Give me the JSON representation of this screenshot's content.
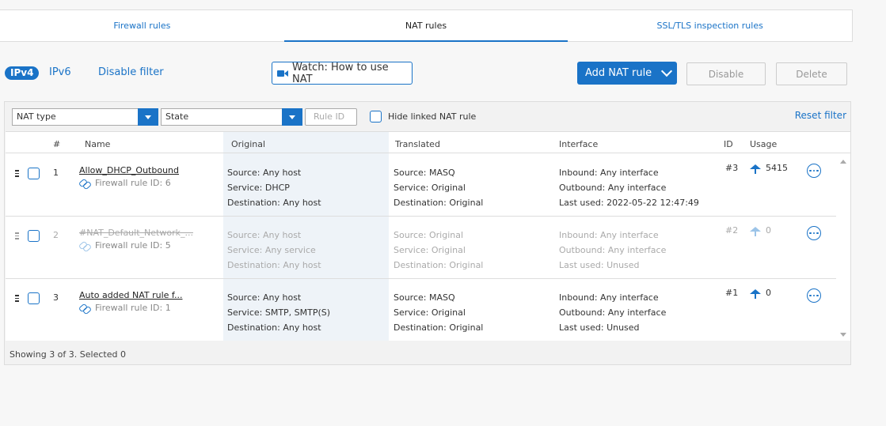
{
  "tabs": [
    {
      "label": "Firewall rules"
    },
    {
      "label": "NAT rules"
    },
    {
      "label": "SSL/TLS inspection rules"
    }
  ],
  "toolbar": {
    "ipv4": "IPv4",
    "ipv6": "IPv6",
    "disable_filter": "Disable filter",
    "watch": "Watch: How to use NAT",
    "add_nat_rule": "Add NAT rule",
    "disable": "Disable",
    "delete": "Delete"
  },
  "filters": {
    "nat_type": "NAT type",
    "state": "State",
    "rule_id_placeholder": "Rule ID",
    "hide_linked": "Hide linked NAT rule",
    "reset": "Reset filter"
  },
  "columns": {
    "num": "#",
    "name": "Name",
    "original": "Original",
    "translated": "Translated",
    "interface": "Interface",
    "id": "ID",
    "usage": "Usage"
  },
  "rows": [
    {
      "num": "1",
      "name": "Allow_DHCP_Outbound",
      "fw": "Firewall rule ID: 6",
      "orig_source": "Source: Any host",
      "orig_service": "Service: DHCP",
      "orig_dest": "Destination: Any host",
      "tr_source": "Source: MASQ",
      "tr_service": "Service: Original",
      "tr_dest": "Destination: Original",
      "inbound": "Inbound: Any interface",
      "outbound": "Outbound: Any interface",
      "last_used": "Last used: 2022-05-22 12:47:49",
      "id": "#3",
      "usage": "5415"
    },
    {
      "num": "2",
      "name": "#NAT_Default_Network_...",
      "fw": "Firewall rule ID: 5",
      "orig_source": "Source: Any host",
      "orig_service": "Service: Any service",
      "orig_dest": "Destination: Any host",
      "tr_source": "Source: Original",
      "tr_service": "Service: Original",
      "tr_dest": "Destination: Original",
      "inbound": "Inbound: Any interface",
      "outbound": "Outbound: Any interface",
      "last_used": "Last used: Unused",
      "id": "#2",
      "usage": "0"
    },
    {
      "num": "3",
      "name": "Auto added NAT rule f...",
      "fw": "Firewall rule ID: 1",
      "orig_source": "Source: Any host",
      "orig_service": "Service: SMTP, SMTP(S)",
      "orig_dest": "Destination: Any host",
      "tr_source": "Source: MASQ",
      "tr_service": "Service: Original",
      "tr_dest": "Destination: Original",
      "inbound": "Inbound: Any interface",
      "outbound": "Outbound: Any interface",
      "last_used": "Last used: Unused",
      "id": "#1",
      "usage": "0"
    }
  ],
  "footer": "Showing 3 of 3. Selected 0",
  "colors": {
    "accent": "#1a73c7"
  }
}
